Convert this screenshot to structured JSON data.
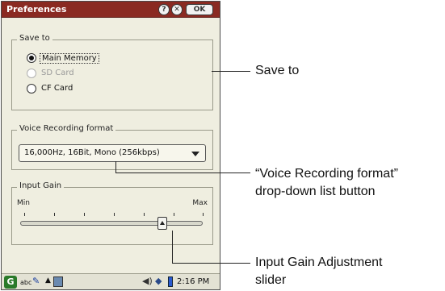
{
  "window": {
    "title": "Preferences",
    "help_label": "?",
    "close_label": "✕",
    "ok_label": "OK"
  },
  "save_to": {
    "legend": "Save to",
    "options": [
      {
        "label": "Main Memory",
        "selected": true,
        "enabled": true
      },
      {
        "label": "SD Card",
        "selected": false,
        "enabled": false
      },
      {
        "label": "CF Card",
        "selected": false,
        "enabled": true
      }
    ]
  },
  "voice_format": {
    "legend": "Voice Recording format",
    "selected_value": "16,000Hz, 16Bit, Mono (256kbps)"
  },
  "input_gain": {
    "legend": "Input Gain",
    "min_label": "Min",
    "max_label": "Max",
    "level_fraction": 0.78
  },
  "taskbar": {
    "abc_label": "abc",
    "clock": "2:16 PM",
    "icons": [
      "app-logo-icon",
      "pen-icon",
      "up-arrow-icon",
      "keyboard-icon",
      "speaker-icon",
      "network-icon",
      "battery-icon"
    ]
  },
  "callouts": {
    "save_to": "Save to",
    "voice_format_line1": "“Voice Recording format”",
    "voice_format_line2": "drop-down list button",
    "gain_line1": "Input Gain Adjustment",
    "gain_line2": "slider"
  },
  "colors": {
    "title_bar": "#8a2a22",
    "dialog_bg": "#efeee0"
  }
}
